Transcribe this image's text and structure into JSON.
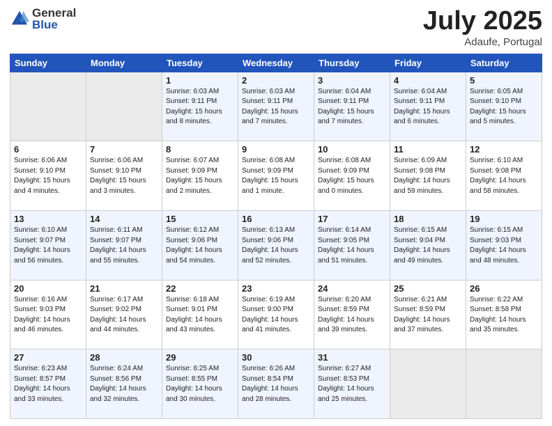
{
  "header": {
    "logo_general": "General",
    "logo_blue": "Blue",
    "title": "July 2025",
    "location": "Adaufe, Portugal"
  },
  "days_of_week": [
    "Sunday",
    "Monday",
    "Tuesday",
    "Wednesday",
    "Thursday",
    "Friday",
    "Saturday"
  ],
  "weeks": [
    [
      {
        "day": "",
        "info": ""
      },
      {
        "day": "",
        "info": ""
      },
      {
        "day": "1",
        "info": "Sunrise: 6:03 AM\nSunset: 9:11 PM\nDaylight: 15 hours\nand 8 minutes."
      },
      {
        "day": "2",
        "info": "Sunrise: 6:03 AM\nSunset: 9:11 PM\nDaylight: 15 hours\nand 7 minutes."
      },
      {
        "day": "3",
        "info": "Sunrise: 6:04 AM\nSunset: 9:11 PM\nDaylight: 15 hours\nand 7 minutes."
      },
      {
        "day": "4",
        "info": "Sunrise: 6:04 AM\nSunset: 9:11 PM\nDaylight: 15 hours\nand 6 minutes."
      },
      {
        "day": "5",
        "info": "Sunrise: 6:05 AM\nSunset: 9:10 PM\nDaylight: 15 hours\nand 5 minutes."
      }
    ],
    [
      {
        "day": "6",
        "info": "Sunrise: 6:06 AM\nSunset: 9:10 PM\nDaylight: 15 hours\nand 4 minutes."
      },
      {
        "day": "7",
        "info": "Sunrise: 6:06 AM\nSunset: 9:10 PM\nDaylight: 15 hours\nand 3 minutes."
      },
      {
        "day": "8",
        "info": "Sunrise: 6:07 AM\nSunset: 9:09 PM\nDaylight: 15 hours\nand 2 minutes."
      },
      {
        "day": "9",
        "info": "Sunrise: 6:08 AM\nSunset: 9:09 PM\nDaylight: 15 hours\nand 1 minute."
      },
      {
        "day": "10",
        "info": "Sunrise: 6:08 AM\nSunset: 9:09 PM\nDaylight: 15 hours\nand 0 minutes."
      },
      {
        "day": "11",
        "info": "Sunrise: 6:09 AM\nSunset: 9:08 PM\nDaylight: 14 hours\nand 59 minutes."
      },
      {
        "day": "12",
        "info": "Sunrise: 6:10 AM\nSunset: 9:08 PM\nDaylight: 14 hours\nand 58 minutes."
      }
    ],
    [
      {
        "day": "13",
        "info": "Sunrise: 6:10 AM\nSunset: 9:07 PM\nDaylight: 14 hours\nand 56 minutes."
      },
      {
        "day": "14",
        "info": "Sunrise: 6:11 AM\nSunset: 9:07 PM\nDaylight: 14 hours\nand 55 minutes."
      },
      {
        "day": "15",
        "info": "Sunrise: 6:12 AM\nSunset: 9:06 PM\nDaylight: 14 hours\nand 54 minutes."
      },
      {
        "day": "16",
        "info": "Sunrise: 6:13 AM\nSunset: 9:06 PM\nDaylight: 14 hours\nand 52 minutes."
      },
      {
        "day": "17",
        "info": "Sunrise: 6:14 AM\nSunset: 9:05 PM\nDaylight: 14 hours\nand 51 minutes."
      },
      {
        "day": "18",
        "info": "Sunrise: 6:15 AM\nSunset: 9:04 PM\nDaylight: 14 hours\nand 49 minutes."
      },
      {
        "day": "19",
        "info": "Sunrise: 6:15 AM\nSunset: 9:03 PM\nDaylight: 14 hours\nand 48 minutes."
      }
    ],
    [
      {
        "day": "20",
        "info": "Sunrise: 6:16 AM\nSunset: 9:03 PM\nDaylight: 14 hours\nand 46 minutes."
      },
      {
        "day": "21",
        "info": "Sunrise: 6:17 AM\nSunset: 9:02 PM\nDaylight: 14 hours\nand 44 minutes."
      },
      {
        "day": "22",
        "info": "Sunrise: 6:18 AM\nSunset: 9:01 PM\nDaylight: 14 hours\nand 43 minutes."
      },
      {
        "day": "23",
        "info": "Sunrise: 6:19 AM\nSunset: 9:00 PM\nDaylight: 14 hours\nand 41 minutes."
      },
      {
        "day": "24",
        "info": "Sunrise: 6:20 AM\nSunset: 8:59 PM\nDaylight: 14 hours\nand 39 minutes."
      },
      {
        "day": "25",
        "info": "Sunrise: 6:21 AM\nSunset: 8:59 PM\nDaylight: 14 hours\nand 37 minutes."
      },
      {
        "day": "26",
        "info": "Sunrise: 6:22 AM\nSunset: 8:58 PM\nDaylight: 14 hours\nand 35 minutes."
      }
    ],
    [
      {
        "day": "27",
        "info": "Sunrise: 6:23 AM\nSunset: 8:57 PM\nDaylight: 14 hours\nand 33 minutes."
      },
      {
        "day": "28",
        "info": "Sunrise: 6:24 AM\nSunset: 8:56 PM\nDaylight: 14 hours\nand 32 minutes."
      },
      {
        "day": "29",
        "info": "Sunrise: 6:25 AM\nSunset: 8:55 PM\nDaylight: 14 hours\nand 30 minutes."
      },
      {
        "day": "30",
        "info": "Sunrise: 6:26 AM\nSunset: 8:54 PM\nDaylight: 14 hours\nand 28 minutes."
      },
      {
        "day": "31",
        "info": "Sunrise: 6:27 AM\nSunset: 8:53 PM\nDaylight: 14 hours\nand 25 minutes."
      },
      {
        "day": "",
        "info": ""
      },
      {
        "day": "",
        "info": ""
      }
    ]
  ]
}
